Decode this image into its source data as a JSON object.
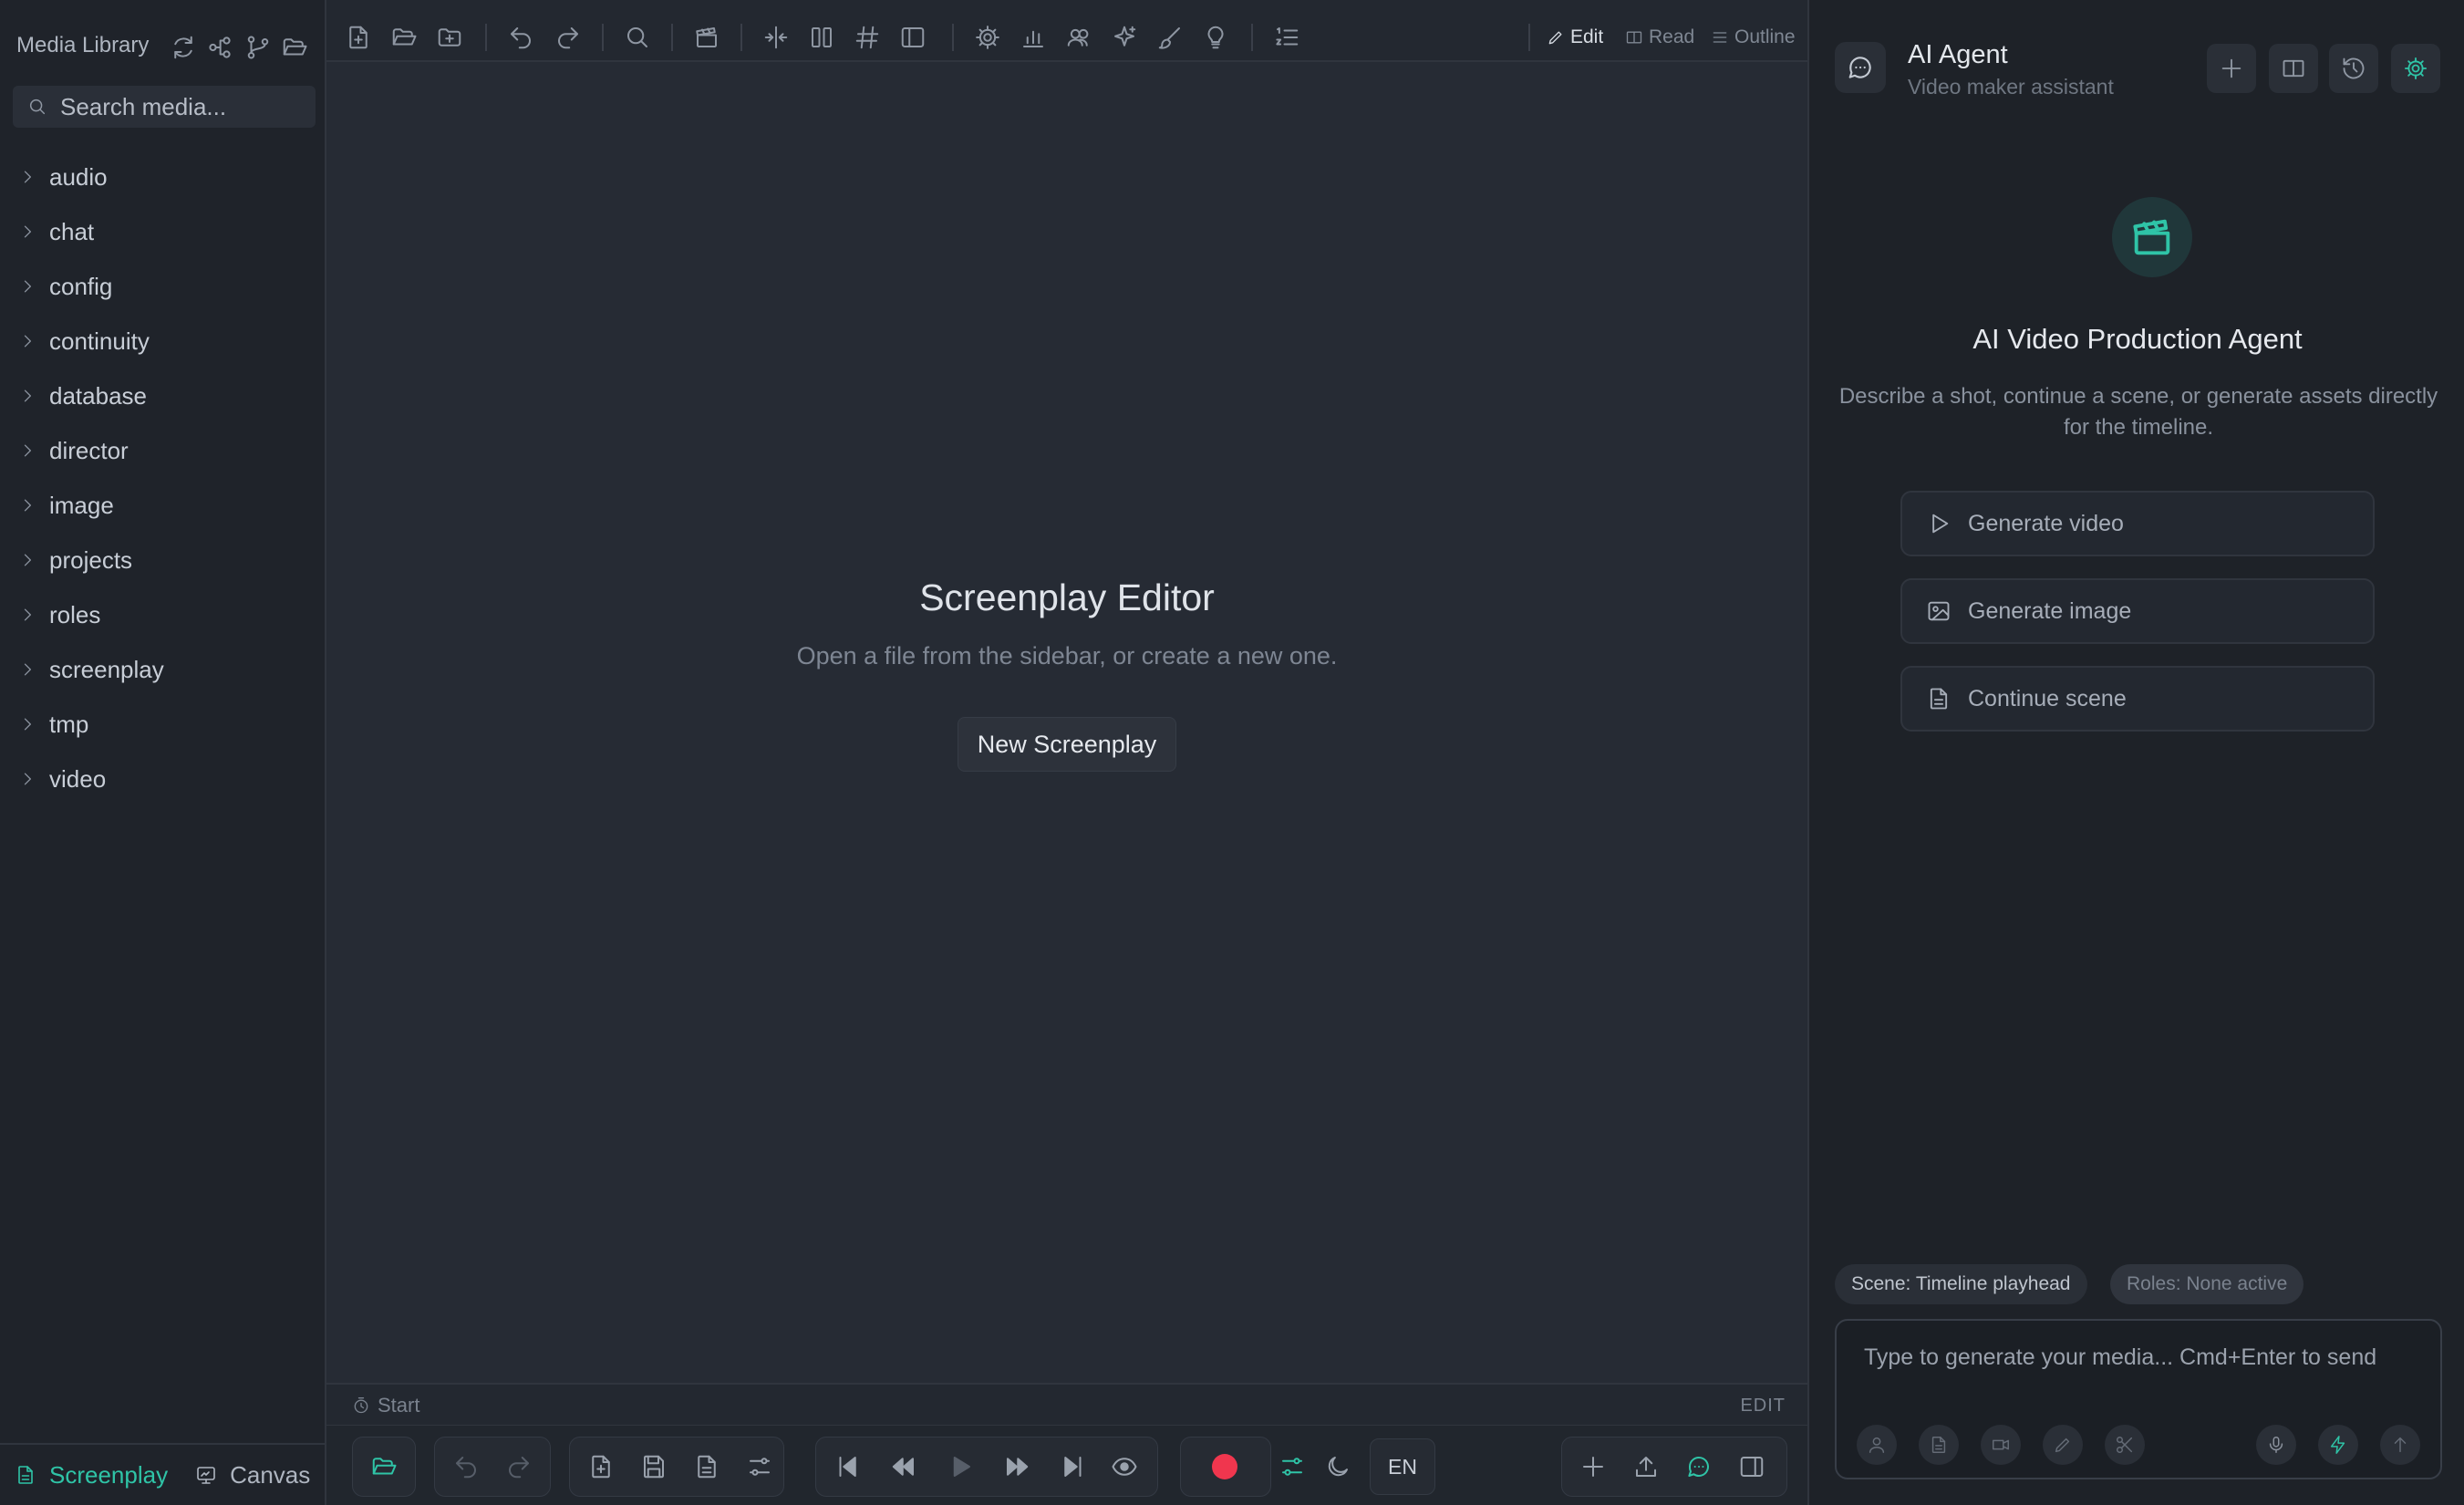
{
  "sidebar": {
    "title": "Media Library",
    "search_placeholder": "Search media...",
    "folders": [
      "audio",
      "chat",
      "config",
      "continuity",
      "database",
      "director",
      "image",
      "projects",
      "roles",
      "screenplay",
      "tmp",
      "video"
    ],
    "footer_tabs": [
      {
        "label": "Screenplay",
        "icon": "file-icon",
        "active": true
      },
      {
        "label": "Canvas",
        "icon": "canvas-icon",
        "active": false
      }
    ]
  },
  "editor": {
    "modes": {
      "edit": "Edit",
      "read": "Read",
      "outline": "Outline"
    },
    "empty_title": "Screenplay Editor",
    "empty_subtitle": "Open a file from the sidebar, or create a new one.",
    "new_button": "New Screenplay",
    "status_start": "Start",
    "status_mode": "EDIT",
    "language": "EN"
  },
  "agent": {
    "name": "AI Agent",
    "subtitle": "Video maker assistant",
    "hero_title": "AI Video Production Agent",
    "hero_desc": "Describe a shot, continue a scene, or generate assets directly for the timeline.",
    "actions": [
      {
        "label": "Generate video",
        "icon": "play-icon"
      },
      {
        "label": "Generate image",
        "icon": "image-icon"
      },
      {
        "label": "Continue scene",
        "icon": "document-icon"
      }
    ],
    "chips": {
      "scene": "Scene: Timeline playhead",
      "roles": "Roles: None active"
    },
    "input_placeholder": "Type to generate your media... Cmd+Enter to send"
  },
  "colors": {
    "accent": "#2fc4a7",
    "record": "#f0364e",
    "background": "#252a33",
    "sidebar": "#1f232a"
  }
}
